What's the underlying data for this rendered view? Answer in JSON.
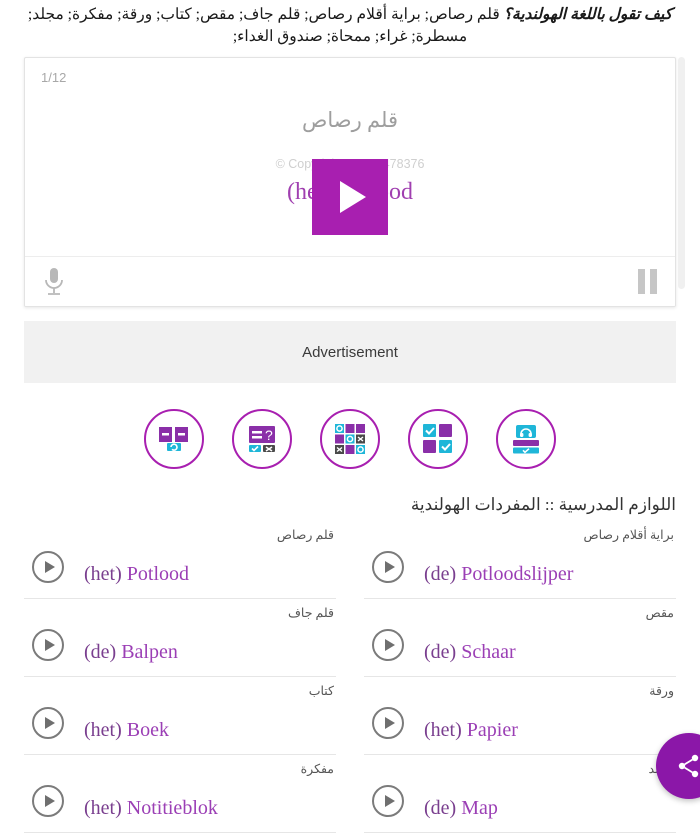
{
  "header": {
    "question_strong": "كيف تقول باللغة الهولندية؟",
    "question_list_line1": "قلم رصاص; براية أقلام رصاص; قلم جاف; مقص; كتاب; ورقة; مفكرة; مجلد;",
    "question_list_line2": "مسطرة; غراء; ممحاة; صندوق الغداء;"
  },
  "player": {
    "slide_counter": "1/12",
    "native_word": "قلم رصاص",
    "copyright": "© Copyright ...com 478376",
    "target_word": "(het) Potlood",
    "play_icon": "play-icon",
    "mic_icon": "microphone-icon",
    "pause_icon": "pause-icon"
  },
  "advertisement": {
    "label": "Advertisement"
  },
  "activities": [
    {
      "name": "flashcards",
      "icon": "flashcards-icon"
    },
    {
      "name": "quiz",
      "icon": "quiz-question-icon"
    },
    {
      "name": "bingo",
      "icon": "bingo-grid-icon"
    },
    {
      "name": "matching",
      "icon": "matching-tiles-icon"
    },
    {
      "name": "listening",
      "icon": "headphones-icon"
    }
  ],
  "vocabulary": {
    "title": "اللوازم المدرسية :: المفردات الهولندية",
    "columns": {
      "left": [
        {
          "native": "قلم رصاص",
          "article": "(het)",
          "word": "Potlood"
        },
        {
          "native": "قلم جاف",
          "article": "(de)",
          "word": "Balpen"
        },
        {
          "native": "كتاب",
          "article": "(het)",
          "word": "Boek"
        },
        {
          "native": "مفكرة",
          "article": "(het)",
          "word": "Notitieblok"
        }
      ],
      "right": [
        {
          "native": "براية أقلام رصاص",
          "article": "(de)",
          "word": "Potloodslijper"
        },
        {
          "native": "مقص",
          "article": "(de)",
          "word": "Schaar"
        },
        {
          "native": "ورقة",
          "article": "(het)",
          "word": "Papier"
        },
        {
          "native": "مجلد",
          "article": "(de)",
          "word": "Map"
        }
      ]
    }
  },
  "share_button": {
    "icon": "share-icon"
  },
  "colors": {
    "brand_purple": "#a81fb0",
    "word_purple": "#9b3fb5",
    "share_purple": "#8b17a8",
    "accent_cyan": "#1fb6d8"
  }
}
